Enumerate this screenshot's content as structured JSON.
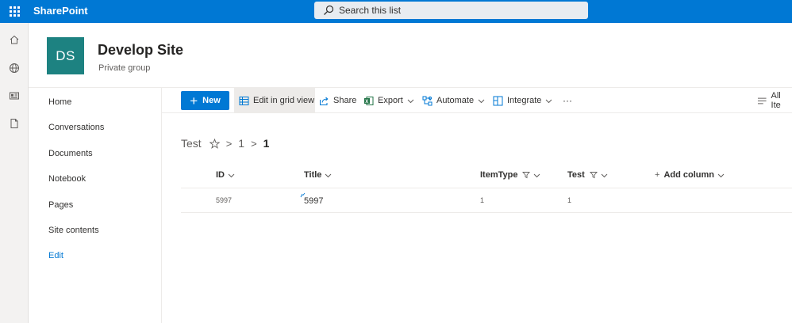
{
  "suite": {
    "brand": "SharePoint",
    "search_placeholder": "Search this list"
  },
  "site": {
    "logo_initials": "DS",
    "title": "Develop Site",
    "subtitle": "Private group"
  },
  "quicklaunch": {
    "items": [
      {
        "label": "Home"
      },
      {
        "label": "Conversations"
      },
      {
        "label": "Documents"
      },
      {
        "label": "Notebook"
      },
      {
        "label": "Pages"
      },
      {
        "label": "Site contents"
      }
    ],
    "edit_label": "Edit"
  },
  "commandbar": {
    "new_label": "New",
    "edit_grid_label": "Edit in grid view",
    "share_label": "Share",
    "export_label": "Export",
    "automate_label": "Automate",
    "integrate_label": "Integrate",
    "more_label": "···",
    "view_label": "All Ite"
  },
  "breadcrumb": {
    "list": "Test",
    "folder": "1",
    "current": "1"
  },
  "list": {
    "columns": {
      "id": "ID",
      "title": "Title",
      "itemtype": "ItemType",
      "test": "Test",
      "add": "Add column"
    },
    "rows": [
      {
        "id": "5997",
        "title": "5997",
        "itemtype": "1",
        "test": "1"
      }
    ]
  },
  "colors": {
    "suitebar": "#0078d4",
    "site_logo": "#1d8281",
    "primary_button": "#0078d4",
    "excel_green": "#217346"
  }
}
